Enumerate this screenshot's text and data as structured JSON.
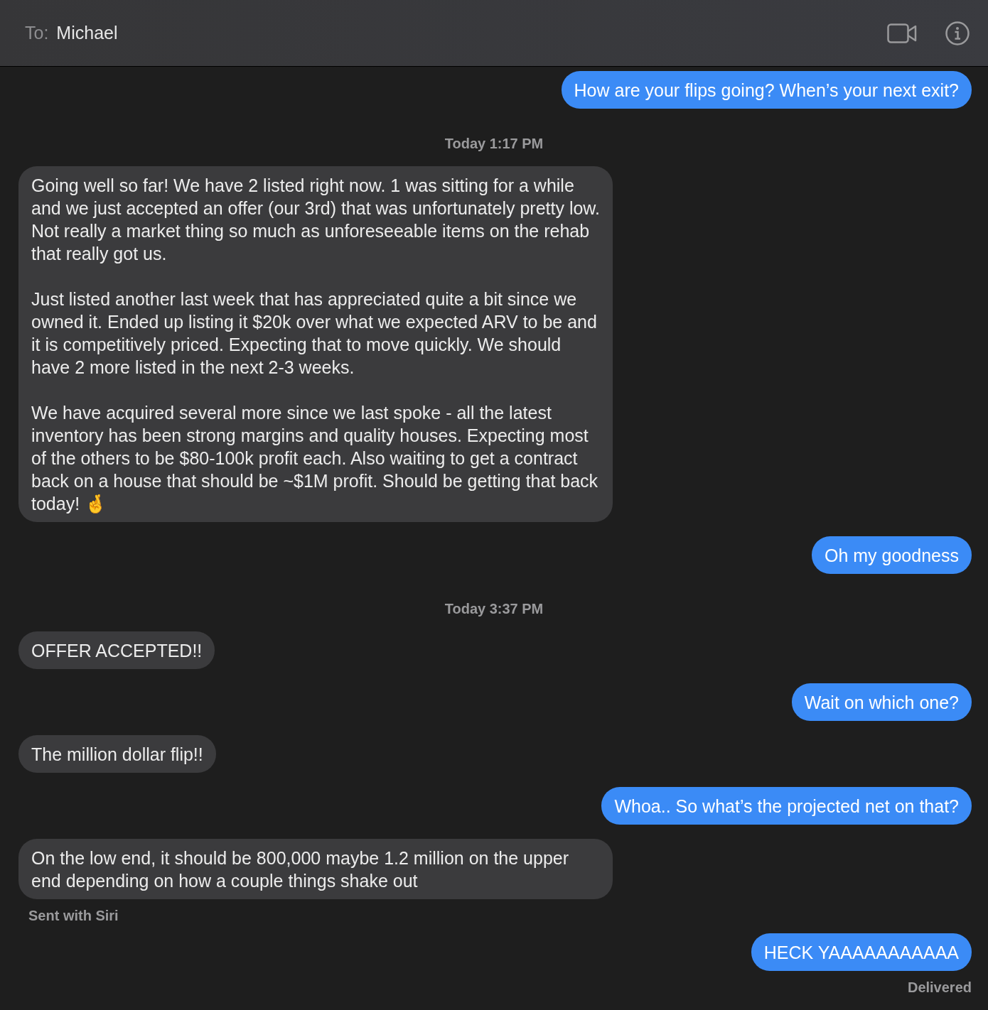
{
  "header": {
    "to_label": "To:",
    "recipient": "Michael"
  },
  "messages": [
    {
      "kind": "sent",
      "text": "How are your flips going? When’s your next exit?"
    },
    {
      "kind": "timestamp",
      "text": "Today 1:17 PM"
    },
    {
      "kind": "received",
      "text": "Going well so far! We have 2 listed right now. 1 was sitting for a while and we just accepted an offer (our 3rd) that was unfortunately pretty low. Not really a market thing so much as unforeseeable items on the rehab that really got us.\n\nJust listed another last week that has appreciated quite a bit since we owned it. Ended up listing it $20k over what we expected ARV to be and it is competitively priced. Expecting that to move quickly. We should have 2 more listed in the next 2-3 weeks.\n\nWe have acquired several more since we last spoke - all the latest inventory has been strong margins and quality houses. Expecting most of the others to be $80-100k profit each. Also waiting to get a contract back on a house that should be ~$1M profit. Should be getting that back today! 🤞"
    },
    {
      "kind": "sent",
      "text": "Oh my goodness"
    },
    {
      "kind": "timestamp",
      "text": "Today 3:37 PM"
    },
    {
      "kind": "received",
      "text": "OFFER ACCEPTED!!"
    },
    {
      "kind": "sent",
      "text": "Wait on which one?"
    },
    {
      "kind": "received",
      "text": "The million dollar flip!!"
    },
    {
      "kind": "sent",
      "text": "Whoa.. So what’s the projected net on that?"
    },
    {
      "kind": "received",
      "text": "On the low end, it should be 800,000 maybe 1.2 million on the upper end depending on how a couple things shake out"
    },
    {
      "kind": "received_note",
      "text": "Sent with Siri"
    },
    {
      "kind": "sent",
      "text": "HECK YAAAAAAAAAAA"
    },
    {
      "kind": "sent_note",
      "text": "Delivered"
    }
  ]
}
